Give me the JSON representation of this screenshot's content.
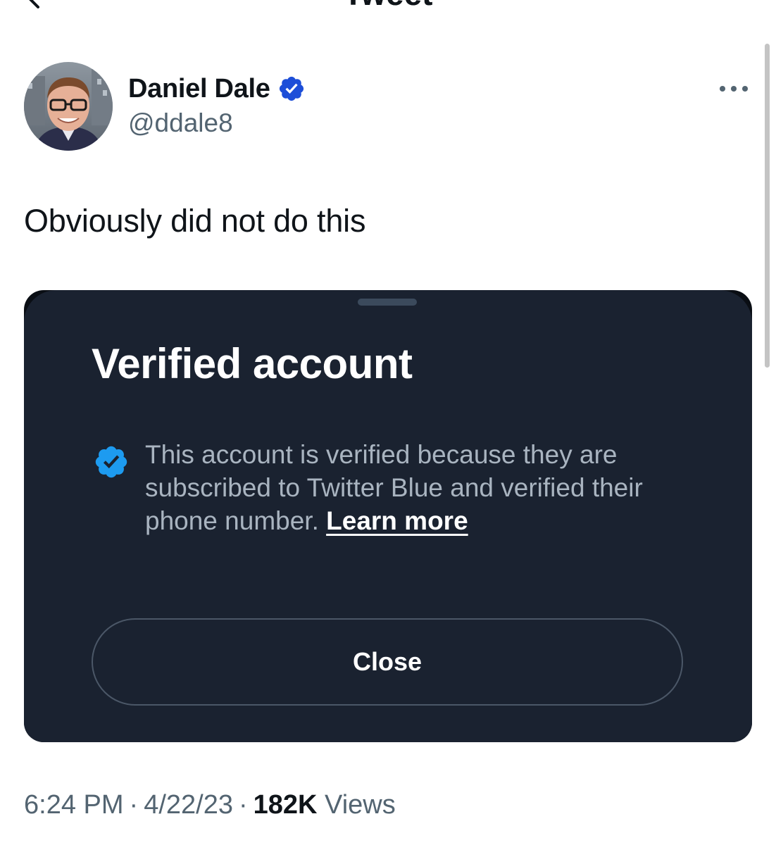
{
  "header": {
    "title": "Tweet",
    "back_icon": "chevron-left-icon"
  },
  "author": {
    "display_name": "Daniel Dale",
    "handle": "@ddale8",
    "verified_icon": "verified-badge-icon",
    "verified_color": "#1d4ed8"
  },
  "more_icon": "more-horizontal-icon",
  "tweet": {
    "text": "Obviously did not do this"
  },
  "embedded_screenshot": {
    "title": "Verified account",
    "description": "This account is verified because they are subscribed to Twitter Blue and verified their phone number.",
    "learn_more": "Learn more",
    "close_label": "Close",
    "badge_icon": "verified-badge-icon",
    "badge_color": "#1d9bf0",
    "background": "#1a2230"
  },
  "meta": {
    "time": "6:24 PM",
    "separator": "·",
    "date": "4/22/23",
    "views_count": "182K",
    "views_label": "Views"
  }
}
